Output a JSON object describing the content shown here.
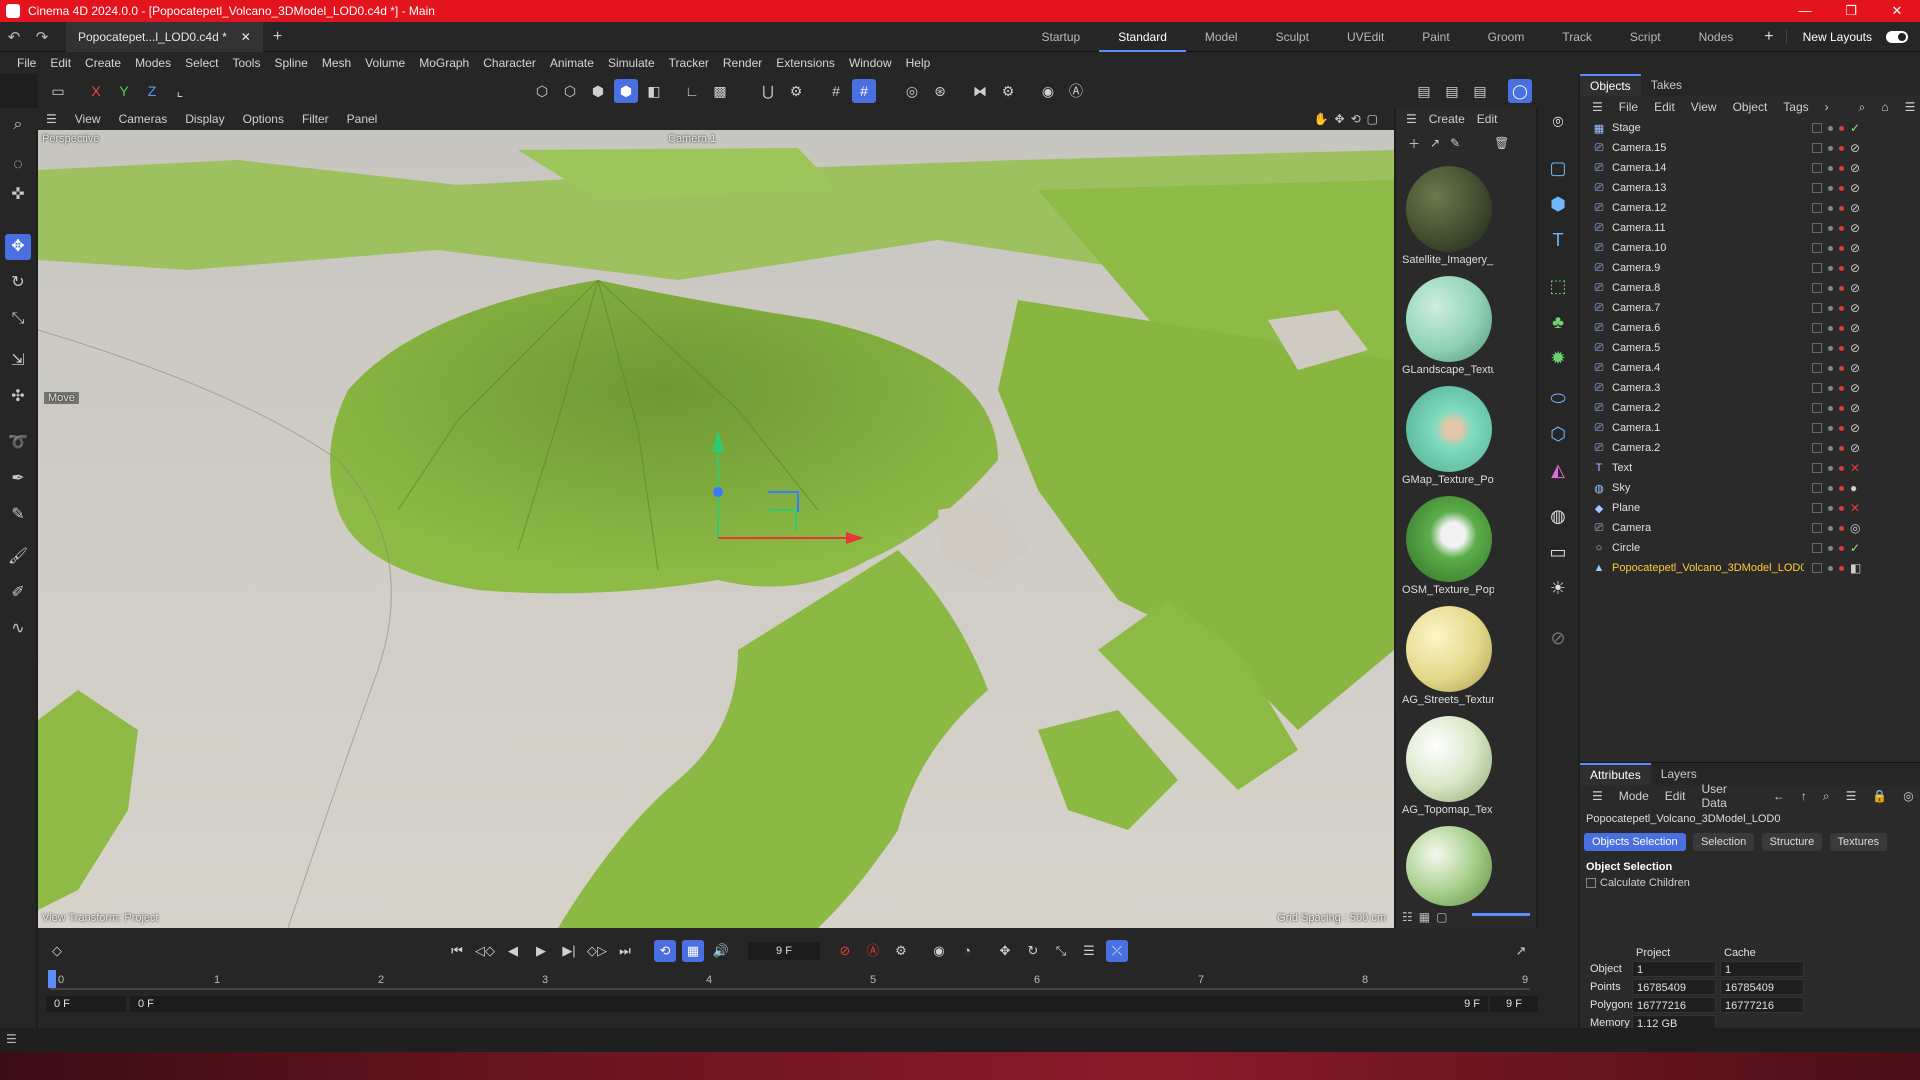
{
  "window": {
    "title": "Cinema 4D 2024.0.0 - [Popocatepetl_Volcano_3DModel_LOD0.c4d *] - Main",
    "controls": [
      "—",
      "❐",
      "✕"
    ]
  },
  "doc_tab": {
    "label": "Popocatepet...l_LOD0.c4d *",
    "close": "✕",
    "add": "+"
  },
  "layouts": {
    "items": [
      "Startup",
      "Standard",
      "Model",
      "Sculpt",
      "UVEdit",
      "Paint",
      "Groom",
      "Track",
      "Script",
      "Nodes"
    ],
    "active": "Standard",
    "add": "+",
    "new_layouts": "New Layouts"
  },
  "menu": [
    "File",
    "Edit",
    "Create",
    "Modes",
    "Select",
    "Tools",
    "Spline",
    "Mesh",
    "Volume",
    "MoGraph",
    "Character",
    "Animate",
    "Simulate",
    "Tracker",
    "Render",
    "Extensions",
    "Window",
    "Help"
  ],
  "axis_buttons": [
    "X",
    "Y",
    "Z"
  ],
  "viewport": {
    "menu": [
      "View",
      "Cameras",
      "Display",
      "Options",
      "Filter",
      "Panel"
    ],
    "projection": "Perspective",
    "camera": "Camera.1",
    "hint": "Move",
    "view_transform": "View Transform: Project",
    "grid_spacing": "Grid Spacing : 500 cm"
  },
  "materials": {
    "menu": [
      "Create",
      "Edit"
    ],
    "items": [
      {
        "name": "Satellite_Imagery_",
        "color": "#3d4a2e"
      },
      {
        "name": "GLandscape_Textu",
        "color": "#8fd2b5"
      },
      {
        "name": "GMap_Texture_Po",
        "color": "#7fdcc0"
      },
      {
        "name": "OSM_Texture_Pop",
        "color": "#5cae4a"
      },
      {
        "name": "AG_Streets_Textur",
        "color": "#e2d88a"
      },
      {
        "name": "AG_Topomap_Tex",
        "color": "#d9e8c8"
      },
      {
        "name": "",
        "color": "#a9d08e"
      }
    ]
  },
  "objects": {
    "tabs": [
      "Objects",
      "Takes"
    ],
    "menu": [
      "File",
      "Edit",
      "View",
      "Object",
      "Tags"
    ],
    "rows": [
      {
        "name": "Stage",
        "icon": "stage-icon",
        "tag": "check"
      },
      {
        "name": "Camera.15",
        "icon": "camera-icon",
        "tag": "protect"
      },
      {
        "name": "Camera.14",
        "icon": "camera-icon",
        "tag": "protect"
      },
      {
        "name": "Camera.13",
        "icon": "camera-icon",
        "tag": "protect"
      },
      {
        "name": "Camera.12",
        "icon": "camera-icon",
        "tag": "protect"
      },
      {
        "name": "Camera.11",
        "icon": "camera-icon",
        "tag": "protect"
      },
      {
        "name": "Camera.10",
        "icon": "camera-icon",
        "tag": "protect"
      },
      {
        "name": "Camera.9",
        "icon": "camera-icon",
        "tag": "protect"
      },
      {
        "name": "Camera.8",
        "icon": "camera-icon",
        "tag": "protect"
      },
      {
        "name": "Camera.7",
        "icon": "camera-icon",
        "tag": "protect"
      },
      {
        "name": "Camera.6",
        "icon": "camera-icon",
        "tag": "protect"
      },
      {
        "name": "Camera.5",
        "icon": "camera-icon",
        "tag": "protect"
      },
      {
        "name": "Camera.4",
        "icon": "camera-icon",
        "tag": "protect"
      },
      {
        "name": "Camera.3",
        "icon": "camera-icon",
        "tag": "protect"
      },
      {
        "name": "Camera.2",
        "icon": "camera-icon",
        "tag": "protect"
      },
      {
        "name": "Camera.1",
        "icon": "camera-icon",
        "tag": "protect"
      },
      {
        "name": "Camera.2",
        "icon": "camera-icon",
        "tag": "protect"
      },
      {
        "name": "Text",
        "icon": "text-icon",
        "tag": "x"
      },
      {
        "name": "Sky",
        "icon": "sky-icon",
        "tag": "sphere"
      },
      {
        "name": "Plane",
        "icon": "plane-icon",
        "tag": "x"
      },
      {
        "name": "Camera",
        "icon": "camera-icon",
        "tag": "target"
      },
      {
        "name": "Circle",
        "icon": "circle-icon",
        "tag": "check"
      },
      {
        "name": "Popocatepetl_Volcano_3DModel_LOD0",
        "icon": "mesh-icon",
        "tag": "material",
        "selected": true
      }
    ]
  },
  "attributes": {
    "tabs": [
      "Attributes",
      "Layers"
    ],
    "menu": [
      "Mode",
      "Edit",
      "User Data"
    ],
    "object_name": "Popocatepetl_Volcano_3DModel_LOD0",
    "buttons": [
      "Objects Selection",
      "Selection",
      "Structure",
      "Textures"
    ],
    "active_button": "Objects Selection",
    "section": "Object Selection",
    "calculate_children": "Calculate Children",
    "col_project": "Project",
    "col_cache": "Cache",
    "rows": [
      {
        "label": "Object",
        "project": "1",
        "cache": "1"
      },
      {
        "label": "Points",
        "project": "16785409",
        "cache": "16785409"
      },
      {
        "label": "Polygons",
        "project": "16777216",
        "cache": "16777216"
      },
      {
        "label": "Memory",
        "project": "1.12 GB",
        "cache": ""
      }
    ]
  },
  "timeline": {
    "current_frame": "9 F",
    "ticks": [
      "0",
      "1",
      "2",
      "3",
      "4",
      "5",
      "6",
      "7",
      "8",
      "9"
    ],
    "start": "0 F",
    "range_start": "0 F",
    "range_end": "9 F",
    "end": "9 F"
  },
  "colors": {
    "title_bar": "#e4141e",
    "accent": "#4a6fe0",
    "selected_object": "#ffcc33",
    "terrain_green": "#8fbd45",
    "terrain_gray": "#c9c5bc"
  }
}
